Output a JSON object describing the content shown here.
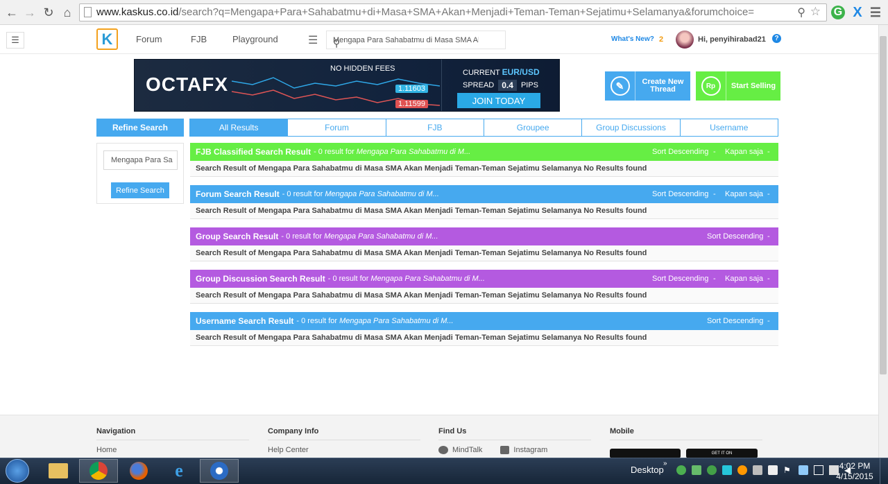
{
  "browser": {
    "url_domain": "www.kaskus.co.id",
    "url_path": "/search?q=Mengapa+Para+Sahabatmu+di+Masa+SMA+Akan+Menjadi+Teman-Teman+Sejatimu+Selamanya&forumchoice="
  },
  "nav": {
    "forum": "Forum",
    "fjb": "FJB",
    "playground": "Playground",
    "search_value": "Mengapa Para Sahabatmu di Masa SMA Akan",
    "whats_new": "What's New?",
    "notif_count": "2",
    "greeting": "Hi, penyihirabad21",
    "help": "?"
  },
  "banner": {
    "brand": "OCTAFX",
    "no_hidden_fees": "NO HIDDEN FEES",
    "price_high": "1.11603",
    "price_low": "1.11599",
    "current": "CURRENT",
    "pair": "EUR/USD",
    "spread": "SPREAD",
    "spread_value": "0.4",
    "pips": "PIPS",
    "join": "JOIN TODAY"
  },
  "actions": {
    "create_thread": "Create New Thread",
    "start_selling": "Start Selling",
    "rp": "Rp"
  },
  "sidebar": {
    "title": "Refine Search",
    "input_value": "Mengapa Para Sa",
    "button": "Refine Search"
  },
  "tabs": [
    "All Results",
    "Forum",
    "FJB",
    "Groupee",
    "Group Discussions",
    "Username"
  ],
  "results": [
    {
      "title": "FJB Classified Search Result",
      "count": "- 0 result for",
      "query": "Mengapa Para Sahabatmu di M...",
      "sort": "Sort Descending",
      "time": "Kapan saja",
      "body": "Search Result of Mengapa Para Sahabatmu di Masa SMA Akan Menjadi Teman-Teman Sejatimu Selamanya No Results found",
      "color": "#66ee44"
    },
    {
      "title": "Forum Search Result",
      "count": "- 0 result for",
      "query": "Mengapa Para Sahabatmu di M...",
      "sort": "Sort Descending",
      "time": "Kapan saja",
      "body": "Search Result of Mengapa Para Sahabatmu di Masa SMA Akan Menjadi Teman-Teman Sejatimu Selamanya No Results found",
      "color": "#46a9ef"
    },
    {
      "title": "Group Search Result",
      "count": "- 0 result for",
      "query": "Mengapa Para Sahabatmu di M...",
      "sort": "Sort Descending",
      "time": "",
      "body": "Search Result of Mengapa Para Sahabatmu di Masa SMA Akan Menjadi Teman-Teman Sejatimu Selamanya No Results found",
      "color": "#b45ae0"
    },
    {
      "title": "Group Discussion Search Result",
      "count": "- 0 result for",
      "query": "Mengapa Para Sahabatmu di M...",
      "sort": "Sort Descending",
      "time": "Kapan saja",
      "body": "Search Result of Mengapa Para Sahabatmu di Masa SMA Akan Menjadi Teman-Teman Sejatimu Selamanya No Results found",
      "color": "#b45ae0"
    },
    {
      "title": "Username Search Result",
      "count": "- 0 result for",
      "query": "Mengapa Para Sahabatmu di M...",
      "sort": "Sort Descending",
      "time": "",
      "body": "Search Result of Mengapa Para Sahabatmu di Masa SMA Akan Menjadi Teman-Teman Sejatimu Selamanya No Results found",
      "color": "#46a9ef"
    }
  ],
  "footer": {
    "navigation": "Navigation",
    "home": "Home",
    "company": "Company Info",
    "help_center": "Help Center",
    "find_us": "Find Us",
    "mindtalk": "MindTalk",
    "instagram": "Instagram",
    "mobile": "Mobile",
    "get_it_on": "GET IT ON"
  },
  "taskbar": {
    "desktop": "Desktop",
    "time": "4:02 PM",
    "date": "4/15/2015"
  }
}
